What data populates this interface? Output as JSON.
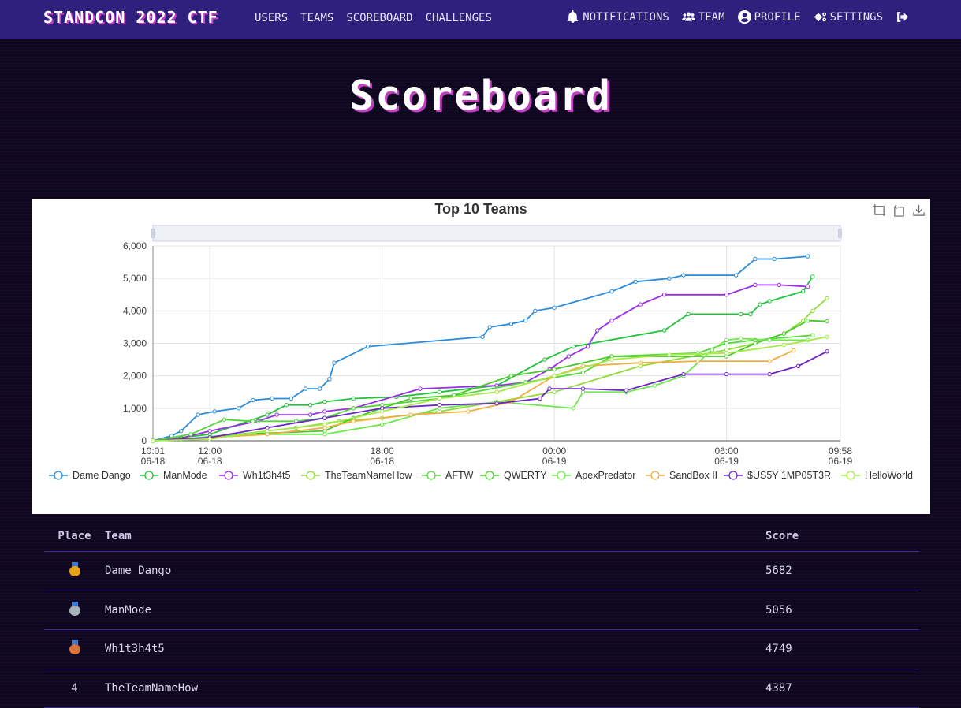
{
  "navbar": {
    "brand": "STANDCON 2022 CTF",
    "links": [
      "USERS",
      "TEAMS",
      "SCOREBOARD",
      "CHALLENGES"
    ],
    "notifications": "NOTIFICATIONS",
    "team": "TEAM",
    "profile": "PROFILE",
    "settings": "SETTINGS",
    "icons": [
      "bell-icon",
      "users-icon",
      "user-circle-icon",
      "cogs-icon",
      "sign-out-icon"
    ]
  },
  "page": {
    "title": "Scoreboard"
  },
  "chart_data": {
    "type": "line",
    "title": "Top 10 Teams",
    "xlabel": "",
    "ylabel": "",
    "ylim": [
      0,
      6000
    ],
    "yticks": [
      "0",
      "1,000",
      "2,000",
      "3,000",
      "4,000",
      "5,000",
      "6,000"
    ],
    "xlim": [
      "06-18 10:01",
      "06-19 09:58"
    ],
    "xticks": [
      {
        "t": "06-18 10:01",
        "time": "10:01",
        "date": "06-18"
      },
      {
        "t": "06-18 12:00",
        "time": "12:00",
        "date": "06-18"
      },
      {
        "t": "06-18 18:00",
        "time": "18:00",
        "date": "06-18"
      },
      {
        "t": "06-19 00:00",
        "time": "00:00",
        "date": "06-19"
      },
      {
        "t": "06-19 06:00",
        "time": "06:00",
        "date": "06-19"
      },
      {
        "t": "06-19 09:58",
        "time": "09:58",
        "date": "06-19"
      }
    ],
    "grid": true,
    "legend_position": "bottom",
    "series": [
      {
        "name": "Dame Dango",
        "color": "#2a8bdc",
        "points": [
          [
            "06-18 10:01",
            0
          ],
          [
            "06-18 10:40",
            150
          ],
          [
            "06-18 11:00",
            300
          ],
          [
            "06-18 11:35",
            800
          ],
          [
            "06-18 12:10",
            900
          ],
          [
            "06-18 13:00",
            1000
          ],
          [
            "06-18 13:30",
            1250
          ],
          [
            "06-18 14:10",
            1300
          ],
          [
            "06-18 14:50",
            1300
          ],
          [
            "06-18 15:20",
            1600
          ],
          [
            "06-18 15:50",
            1600
          ],
          [
            "06-18 16:10",
            1900
          ],
          [
            "06-18 16:20",
            2400
          ],
          [
            "06-18 17:30",
            2900
          ],
          [
            "06-18 21:30",
            3200
          ],
          [
            "06-18 21:45",
            3500
          ],
          [
            "06-18 22:30",
            3600
          ],
          [
            "06-18 23:00",
            3700
          ],
          [
            "06-18 23:20",
            4000
          ],
          [
            "06-19 00:00",
            4100
          ],
          [
            "06-19 02:00",
            4600
          ],
          [
            "06-19 02:50",
            4900
          ],
          [
            "06-19 04:00",
            5000
          ],
          [
            "06-19 04:30",
            5100
          ],
          [
            "06-19 06:20",
            5100
          ],
          [
            "06-19 07:00",
            5600
          ],
          [
            "06-19 07:40",
            5600
          ],
          [
            "06-19 08:50",
            5682
          ]
        ]
      },
      {
        "name": "ManMode",
        "color": "#1fc43a",
        "points": [
          [
            "06-18 10:01",
            0
          ],
          [
            "06-18 11:00",
            100
          ],
          [
            "06-18 12:00",
            200
          ],
          [
            "06-18 14:00",
            800
          ],
          [
            "06-18 14:40",
            1100
          ],
          [
            "06-18 15:30",
            1100
          ],
          [
            "06-18 16:00",
            1200
          ],
          [
            "06-18 17:00",
            1300
          ],
          [
            "06-18 18:30",
            1350
          ],
          [
            "06-18 20:00",
            1500
          ],
          [
            "06-18 22:00",
            1700
          ],
          [
            "06-18 23:40",
            2500
          ],
          [
            "06-19 00:40",
            2900
          ],
          [
            "06-19 03:50",
            3400
          ],
          [
            "06-19 04:40",
            3900
          ],
          [
            "06-19 06:30",
            3900
          ],
          [
            "06-19 06:50",
            3900
          ],
          [
            "06-19 07:10",
            4200
          ],
          [
            "06-19 07:30",
            4300
          ],
          [
            "06-19 08:40",
            4600
          ],
          [
            "06-19 09:00",
            5056
          ]
        ]
      },
      {
        "name": "Wh1t3h4t5",
        "color": "#9a2ce8",
        "points": [
          [
            "06-18 10:01",
            0
          ],
          [
            "06-18 11:00",
            80
          ],
          [
            "06-18 12:00",
            300
          ],
          [
            "06-18 13:40",
            600
          ],
          [
            "06-18 14:20",
            800
          ],
          [
            "06-18 15:30",
            800
          ],
          [
            "06-18 16:00",
            900
          ],
          [
            "06-18 17:00",
            1000
          ],
          [
            "06-18 19:20",
            1600
          ],
          [
            "06-18 22:00",
            1700
          ],
          [
            "06-18 23:00",
            1800
          ],
          [
            "06-18 23:50",
            2200
          ],
          [
            "06-19 00:30",
            2600
          ],
          [
            "06-19 01:10",
            2900
          ],
          [
            "06-19 01:30",
            3400
          ],
          [
            "06-19 02:00",
            3700
          ],
          [
            "06-19 03:00",
            4200
          ],
          [
            "06-19 03:50",
            4500
          ],
          [
            "06-19 06:00",
            4500
          ],
          [
            "06-19 07:00",
            4800
          ],
          [
            "06-19 07:50",
            4800
          ],
          [
            "06-19 08:50",
            4749
          ]
        ]
      },
      {
        "name": "TheTeamNameHow",
        "color": "#8fdc3a",
        "points": [
          [
            "06-18 10:01",
            0
          ],
          [
            "06-18 12:00",
            100
          ],
          [
            "06-18 15:00",
            400
          ],
          [
            "06-18 16:30",
            600
          ],
          [
            "06-18 18:00",
            700
          ],
          [
            "06-18 20:00",
            900
          ],
          [
            "06-18 22:00",
            1200
          ],
          [
            "06-19 00:00",
            1500
          ],
          [
            "06-19 03:00",
            2300
          ],
          [
            "06-19 06:00",
            2800
          ],
          [
            "06-19 07:00",
            3000
          ],
          [
            "06-19 08:00",
            3300
          ],
          [
            "06-19 08:40",
            3700
          ],
          [
            "06-19 09:00",
            4000
          ],
          [
            "06-19 09:30",
            4387
          ]
        ]
      },
      {
        "name": "AFTW",
        "color": "#52d838",
        "points": [
          [
            "06-18 10:01",
            0
          ],
          [
            "06-18 11:20",
            200
          ],
          [
            "06-18 12:30",
            650
          ],
          [
            "06-18 13:30",
            600
          ],
          [
            "06-18 15:00",
            600
          ],
          [
            "06-18 16:00",
            700
          ],
          [
            "06-18 17:00",
            1000
          ],
          [
            "06-18 18:00",
            1100
          ],
          [
            "06-18 20:00",
            1300
          ],
          [
            "06-18 23:00",
            1800
          ],
          [
            "06-19 01:00",
            2100
          ],
          [
            "06-19 02:00",
            2600
          ],
          [
            "06-19 05:00",
            2700
          ],
          [
            "06-19 06:00",
            3000
          ],
          [
            "06-19 07:00",
            3100
          ],
          [
            "06-19 09:00",
            3250
          ]
        ]
      },
      {
        "name": "QWERTY",
        "color": "#48c82a",
        "points": [
          [
            "06-18 10:01",
            0
          ],
          [
            "06-18 11:00",
            50
          ],
          [
            "06-18 13:00",
            200
          ],
          [
            "06-18 16:00",
            300
          ],
          [
            "06-18 17:00",
            700
          ],
          [
            "06-18 19:00",
            1300
          ],
          [
            "06-18 20:30",
            1400
          ],
          [
            "06-18 22:30",
            2000
          ],
          [
            "06-19 00:00",
            2200
          ],
          [
            "06-19 02:00",
            2600
          ],
          [
            "06-19 06:00",
            2600
          ],
          [
            "06-19 07:00",
            3000
          ],
          [
            "06-19 08:00",
            3300
          ],
          [
            "06-19 08:50",
            3700
          ],
          [
            "06-19 09:30",
            3680
          ]
        ]
      },
      {
        "name": "ApexPredator",
        "color": "#6ee84a",
        "points": [
          [
            "06-18 10:01",
            0
          ],
          [
            "06-18 12:00",
            100
          ],
          [
            "06-18 14:00",
            200
          ],
          [
            "06-18 16:00",
            200
          ],
          [
            "06-18 18:00",
            500
          ],
          [
            "06-18 20:00",
            1000
          ],
          [
            "06-18 22:00",
            1200
          ],
          [
            "06-19 00:40",
            1000
          ],
          [
            "06-19 01:00",
            1500
          ],
          [
            "06-19 02:30",
            1500
          ],
          [
            "06-19 03:30",
            1700
          ],
          [
            "06-19 04:30",
            2000
          ],
          [
            "06-19 05:30",
            2800
          ],
          [
            "06-19 06:00",
            3100
          ],
          [
            "06-19 06:30",
            3150
          ],
          [
            "06-19 07:30",
            3100
          ],
          [
            "06-19 08:50",
            3100
          ]
        ]
      },
      {
        "name": "SandBox II",
        "color": "#f0ae40",
        "points": [
          [
            "06-18 10:01",
            0
          ],
          [
            "06-18 12:00",
            100
          ],
          [
            "06-18 14:00",
            200
          ],
          [
            "06-18 16:00",
            400
          ],
          [
            "06-18 17:00",
            600
          ],
          [
            "06-18 19:00",
            800
          ],
          [
            "06-18 21:00",
            900
          ],
          [
            "06-18 22:30",
            1200
          ],
          [
            "06-19 00:00",
            2000
          ],
          [
            "06-19 01:00",
            2300
          ],
          [
            "06-19 03:00",
            2400
          ],
          [
            "06-19 05:00",
            2450
          ],
          [
            "06-19 07:30",
            2450
          ],
          [
            "06-19 08:20",
            2780
          ]
        ]
      },
      {
        "name": "$US5Y 1MP05T3R",
        "color": "#6e22c8",
        "points": [
          [
            "06-18 10:01",
            0
          ],
          [
            "06-18 12:00",
            100
          ],
          [
            "06-18 14:00",
            400
          ],
          [
            "06-18 16:00",
            700
          ],
          [
            "06-18 18:00",
            1000
          ],
          [
            "06-18 20:00",
            1100
          ],
          [
            "06-18 22:00",
            1150
          ],
          [
            "06-18 23:30",
            1300
          ],
          [
            "06-18 23:50",
            1600
          ],
          [
            "06-19 01:00",
            1600
          ],
          [
            "06-19 02:30",
            1550
          ],
          [
            "06-19 04:30",
            2050
          ],
          [
            "06-19 06:00",
            2050
          ],
          [
            "06-19 07:30",
            2050
          ],
          [
            "06-19 08:30",
            2300
          ],
          [
            "06-19 09:30",
            2750
          ]
        ]
      },
      {
        "name": "HelloWorld",
        "color": "#a6ea48",
        "points": [
          [
            "06-18 10:01",
            0
          ],
          [
            "06-18 12:00",
            50
          ],
          [
            "06-18 14:00",
            300
          ],
          [
            "06-18 16:00",
            500
          ],
          [
            "06-18 18:00",
            900
          ],
          [
            "06-18 20:00",
            1300
          ],
          [
            "06-18 22:00",
            1500
          ],
          [
            "06-19 00:00",
            2000
          ],
          [
            "06-19 02:00",
            2500
          ],
          [
            "06-19 04:00",
            2650
          ],
          [
            "06-19 06:00",
            2700
          ],
          [
            "06-19 08:00",
            2950
          ],
          [
            "06-19 09:30",
            3200
          ]
        ]
      }
    ]
  },
  "scoreboard": {
    "headers": {
      "place": "Place",
      "team": "Team",
      "score": "Score"
    },
    "rows": [
      {
        "place": "",
        "medal": "gold",
        "medal_color": "#e8a317",
        "team": "Dame Dango",
        "score": "5682"
      },
      {
        "place": "",
        "medal": "silver",
        "medal_color": "#a7b1ba",
        "team": "ManMode",
        "score": "5056"
      },
      {
        "place": "",
        "medal": "bronze",
        "medal_color": "#d9743a",
        "team": "Wh1t3h4t5",
        "score": "4749"
      },
      {
        "place": "4",
        "medal": "",
        "medal_color": "",
        "team": "TheTeamNameHow",
        "score": "4387"
      }
    ]
  }
}
